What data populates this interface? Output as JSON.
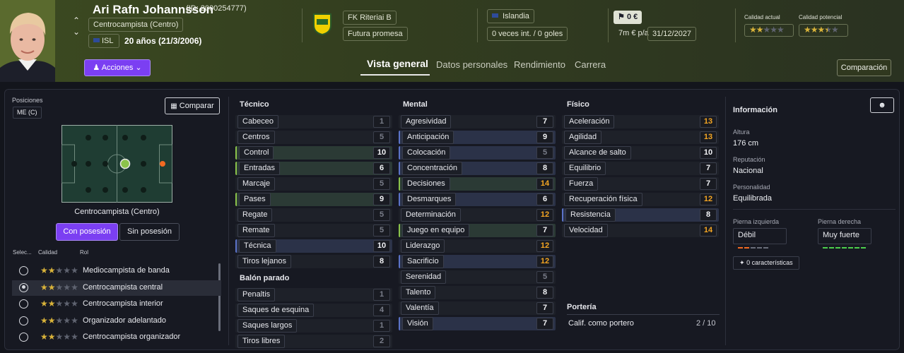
{
  "player": {
    "name": "Ari Rafn Johannsson",
    "id": "(ID: 2000254777)",
    "position": "Centrocampista (Centro)",
    "nation_code": "ISL",
    "age": "20 años (21/3/2006)",
    "club": "FK Riteriai B",
    "status": "Futura promesa",
    "nation": "Islandia",
    "caps": "0 veces int. / 0 goles",
    "value": "0 €",
    "wage": "7m € p/a",
    "contract": "31/12/2027",
    "current_ability_label": "Calidad actual",
    "potential_ability_label": "Calidad potencial",
    "current_ability_stars": 2,
    "potential_ability_stars": 3.5,
    "actions_label": "Acciones"
  },
  "tabs": [
    "Vista general",
    "Datos personales",
    "Rendimiento",
    "Carrera"
  ],
  "compare_btn": "Comparación",
  "left": {
    "positions_label": "Posiciones",
    "position_badge": "ME (C)",
    "compare_label": "Comparar",
    "pitch_caption": "Centrocampista (Centro)",
    "toggle_on": "Con posesión",
    "toggle_off": "Sin posesión",
    "col_select": "Selec...",
    "col_quality": "Calidad",
    "col_role": "Rol",
    "roles": [
      {
        "name": "Mediocampista de banda",
        "stars": 2,
        "selected": false
      },
      {
        "name": "Centrocampista central",
        "stars": 2,
        "selected": true
      },
      {
        "name": "Centrocampista interior",
        "stars": 2,
        "selected": false
      },
      {
        "name": "Organizador adelantado",
        "stars": 2,
        "selected": false
      },
      {
        "name": "Centrocampista organizador",
        "stars": 2,
        "selected": false
      }
    ]
  },
  "tecnico": {
    "title": "Técnico",
    "attrs": [
      {
        "name": "Cabeceo",
        "value": "1",
        "c": "grey",
        "hl": ""
      },
      {
        "name": "Centros",
        "value": "5",
        "c": "grey",
        "hl": ""
      },
      {
        "name": "Control",
        "value": "10",
        "c": "white",
        "hl": "g"
      },
      {
        "name": "Entradas",
        "value": "6",
        "c": "white",
        "hl": "g"
      },
      {
        "name": "Marcaje",
        "value": "5",
        "c": "grey",
        "hl": ""
      },
      {
        "name": "Pases",
        "value": "9",
        "c": "white",
        "hl": "g"
      },
      {
        "name": "Regate",
        "value": "5",
        "c": "grey",
        "hl": ""
      },
      {
        "name": "Remate",
        "value": "5",
        "c": "grey",
        "hl": ""
      },
      {
        "name": "Técnica",
        "value": "10",
        "c": "white",
        "hl": "b"
      },
      {
        "name": "Tiros lejanos",
        "value": "8",
        "c": "white",
        "hl": ""
      }
    ]
  },
  "balon": {
    "title": "Balón parado",
    "attrs": [
      {
        "name": "Penaltis",
        "value": "1",
        "c": "grey",
        "hl": ""
      },
      {
        "name": "Saques de esquina",
        "value": "4",
        "c": "grey",
        "hl": ""
      },
      {
        "name": "Saques largos",
        "value": "1",
        "c": "grey",
        "hl": ""
      },
      {
        "name": "Tiros libres",
        "value": "2",
        "c": "grey",
        "hl": ""
      }
    ]
  },
  "mental": {
    "title": "Mental",
    "attrs": [
      {
        "name": "Agresividad",
        "value": "7",
        "c": "white",
        "hl": ""
      },
      {
        "name": "Anticipación",
        "value": "9",
        "c": "white",
        "hl": "b"
      },
      {
        "name": "Colocación",
        "value": "5",
        "c": "grey",
        "hl": "b"
      },
      {
        "name": "Concentración",
        "value": "8",
        "c": "white",
        "hl": "b"
      },
      {
        "name": "Decisiones",
        "value": "14",
        "c": "orange",
        "hl": "g"
      },
      {
        "name": "Desmarques",
        "value": "6",
        "c": "white",
        "hl": "b"
      },
      {
        "name": "Determinación",
        "value": "12",
        "c": "orange",
        "hl": ""
      },
      {
        "name": "Juego en equipo",
        "value": "7",
        "c": "white",
        "hl": "g"
      },
      {
        "name": "Liderazgo",
        "value": "12",
        "c": "orange",
        "hl": ""
      },
      {
        "name": "Sacrificio",
        "value": "12",
        "c": "orange",
        "hl": "b"
      },
      {
        "name": "Serenidad",
        "value": "5",
        "c": "grey",
        "hl": ""
      },
      {
        "name": "Talento",
        "value": "8",
        "c": "white",
        "hl": ""
      },
      {
        "name": "Valentía",
        "value": "7",
        "c": "white",
        "hl": ""
      },
      {
        "name": "Visión",
        "value": "7",
        "c": "white",
        "hl": "b"
      }
    ]
  },
  "fisico": {
    "title": "Físico",
    "attrs": [
      {
        "name": "Aceleración",
        "value": "13",
        "c": "orange",
        "hl": ""
      },
      {
        "name": "Agilidad",
        "value": "13",
        "c": "orange",
        "hl": ""
      },
      {
        "name": "Alcance de salto",
        "value": "10",
        "c": "white",
        "hl": ""
      },
      {
        "name": "Equilibrio",
        "value": "7",
        "c": "white",
        "hl": ""
      },
      {
        "name": "Fuerza",
        "value": "7",
        "c": "white",
        "hl": ""
      },
      {
        "name": "Recuperación física",
        "value": "12",
        "c": "orange",
        "hl": ""
      },
      {
        "name": "Resistencia",
        "value": "8",
        "c": "white",
        "hl": "b"
      },
      {
        "name": "Velocidad",
        "value": "14",
        "c": "orange",
        "hl": ""
      }
    ]
  },
  "porteria": {
    "title": "Portería",
    "label": "Calif. como portero",
    "value": "2 / 10"
  },
  "info": {
    "title": "Información",
    "height_label": "Altura",
    "height": "176 cm",
    "rep_label": "Reputación",
    "rep": "Nacional",
    "pers_label": "Personalidad",
    "pers": "Equilibrada",
    "left_foot_label": "Pierna izquierda",
    "left_foot": "Débil",
    "right_foot_label": "Pierna derecha",
    "right_foot": "Muy fuerte",
    "traits": "0 características"
  },
  "colors": {
    "accent": "#7b3ff2",
    "grey": "#7a7e8a",
    "orange": "#f5a623",
    "good": "#8bc34a",
    "pitch": "#1f3d33"
  }
}
